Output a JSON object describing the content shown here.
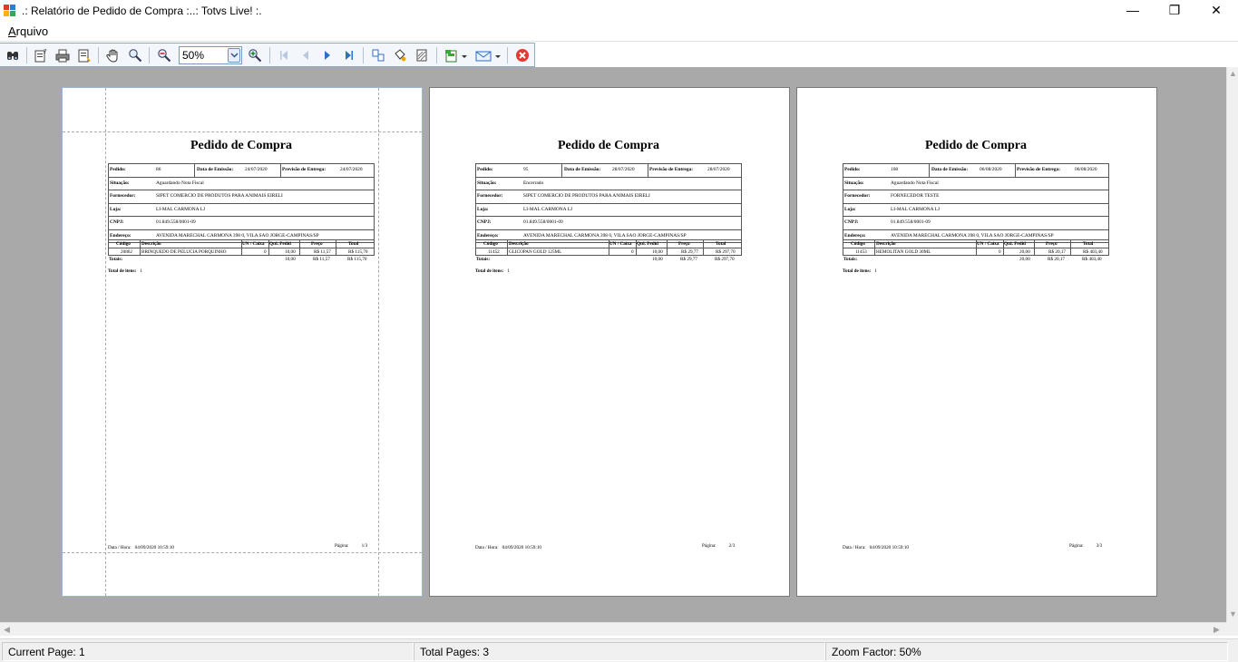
{
  "window": {
    "title": ".: Relatório de Pedido de Compra :..: Totvs Live! :.",
    "minimize_glyph": "—",
    "maximize_glyph": "❐",
    "close_glyph": "✕"
  },
  "menu": {
    "arquivo_accel": "A",
    "arquivo_rest": "rquivo"
  },
  "toolbar": {
    "zoom_value": "50%",
    "icons": [
      "find-icon",
      "page-setup-icon",
      "print-icon",
      "print-preview-icon",
      "hand-icon",
      "magnifier-icon",
      "zoom-out-icon",
      "zoom-in-icon",
      "first-page-icon",
      "previous-page-icon",
      "next-page-icon",
      "last-page-icon",
      "multipage-icon",
      "backcolor-icon",
      "watermark-icon",
      "export-icon",
      "email-icon",
      "close-preview-icon"
    ]
  },
  "colors": {
    "viewport_bg": "#a9a9a9",
    "close_button_red": "#e53935",
    "nav_arrow_blue": "#2f6fc2"
  },
  "labels": {
    "report_title": "Pedido de Compra",
    "pedido": "Pedido:",
    "data_emissao": "Data de Emissão:",
    "previsao": "Previsão de Entrega:",
    "situacao": "Situação:",
    "fornecedor": "Fornecedor:",
    "loja": "Loja:",
    "cnpj": "CNPJ:",
    "endereco": "Endereço:",
    "col_codigo": "Código",
    "col_descricao": "Descrição",
    "col_un": "UN / Caixa",
    "col_qtd": "Qtd. Pedid",
    "col_preco": "Preço",
    "col_total": "Total",
    "totais": "Totais:",
    "total_itens": "Total de itens:",
    "data_hora": "Data / Hora:",
    "pagina": "Página:"
  },
  "pages": [
    {
      "pedido": "86",
      "data_emissao": "24/07/2020",
      "previsao": "24/07/2020",
      "situacao": "Aguardando Nota Fiscal",
      "fornecedor": "SIPET COMERCIO DE PRODUTOS PARA ANIMAIS EIRELI",
      "loja": "LI-MAL CARMONA LJ",
      "cnpj": "01.849.558/0001-09",
      "endereco": "AVENIDA MARECHAL CARMONA 398 0, VILA SAO JORGE-CAMPINAS/SP",
      "item_codigo": "20862",
      "item_descricao": "BRINQUEDO DE PELUCIA PORQUINHO",
      "item_un": "0",
      "item_qtd": "10,00",
      "item_preco": "R$ 11,57",
      "item_total": "R$ 115,70",
      "tot_qtd": "10,00",
      "tot_preco": "R$ 11,57",
      "tot_total": "R$ 115,70",
      "total_itens": "1",
      "data_hora": "04/09/2020 10:59:10",
      "pagina": "1/3"
    },
    {
      "pedido": "95",
      "data_emissao": "28/07/2020",
      "previsao": "28/07/2020",
      "situacao": "Encerrado",
      "fornecedor": "SIPET COMERCIO DE PRODUTOS PARA ANIMAIS EIRELI",
      "loja": "LI-MAL CARMONA LJ",
      "cnpj": "01.849.558/0001-09",
      "endereco": "AVENIDA MARECHAL CARMONA 398 0, VILA SAO JORGE-CAMPINAS/SP",
      "item_codigo": "11452",
      "item_descricao": "GLICOPAN GOLD 125ML",
      "item_un": "0",
      "item_qtd": "10,00",
      "item_preco": "R$ 29,77",
      "item_total": "R$ 297,70",
      "tot_qtd": "10,00",
      "tot_preco": "R$ 29,77",
      "tot_total": "R$ 297,70",
      "total_itens": "1",
      "data_hora": "04/09/2020 10:59:10",
      "pagina": "2/3"
    },
    {
      "pedido": "108",
      "data_emissao": "06/08/2020",
      "previsao": "06/08/2020",
      "situacao": "Aguardando Nota Fiscal",
      "fornecedor": "FORNECEDOR TESTE",
      "loja": "LI-MAL CARMONA LJ",
      "cnpj": "01.849.558/0001-09",
      "endereco": "AVENIDA MARECHAL CARMONA 398 0, VILA SAO JORGE-CAMPINAS/SP",
      "item_codigo": "11453",
      "item_descricao": "HEMOLITAN GOLD 30ML",
      "item_un": "0",
      "item_qtd": "20,00",
      "item_preco": "R$ 20,17",
      "item_total": "R$ 403,40",
      "tot_qtd": "20,00",
      "tot_preco": "R$ 20,17",
      "tot_total": "R$ 403,40",
      "total_itens": "1",
      "data_hora": "04/09/2020 10:59:10",
      "pagina": "3/3"
    }
  ],
  "status": {
    "current_page": "Current Page: 1",
    "total_pages": "Total Pages: 3",
    "zoom_factor": "Zoom Factor: 50%"
  }
}
